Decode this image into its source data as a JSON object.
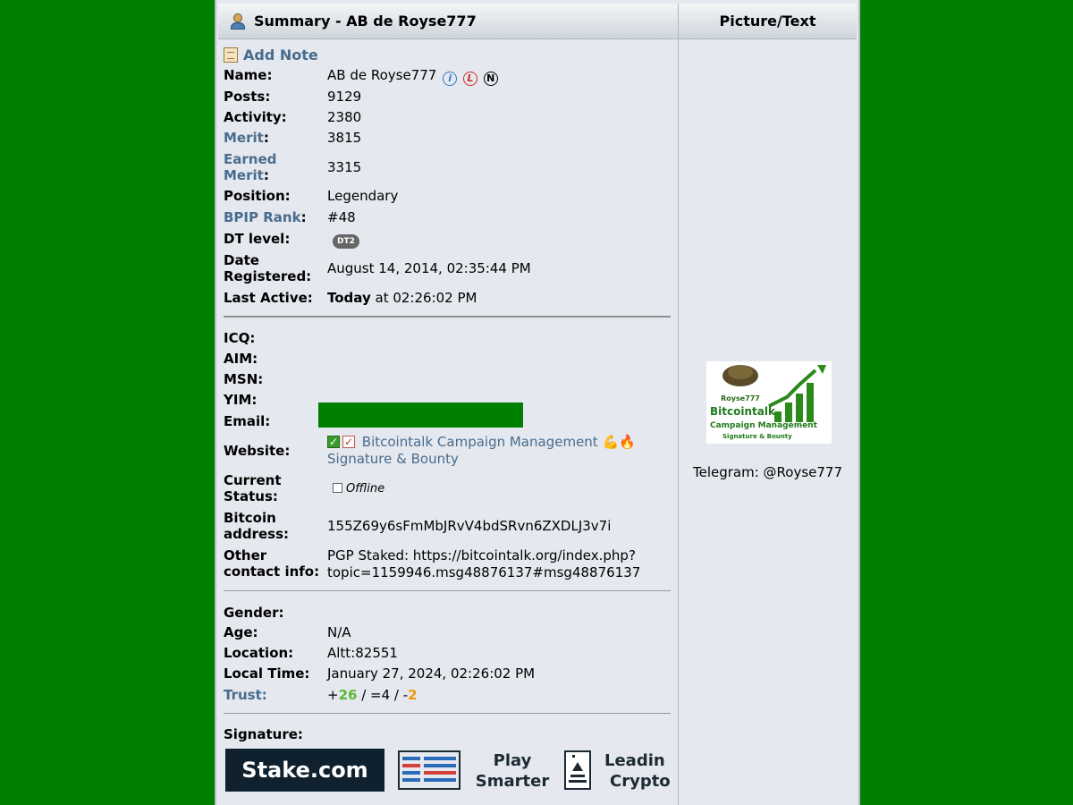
{
  "header": {
    "summary_title": "Summary - AB de Royse777",
    "picture_title": "Picture/Text"
  },
  "add_note": "Add Note",
  "profile": {
    "name_label": "Name:",
    "name": "AB de Royse777",
    "posts_label": "Posts:",
    "posts": "9129",
    "activity_label": "Activity:",
    "activity": "2380",
    "merit_label": "Merit",
    "merit": "3815",
    "earned_merit_label_1": "Earned",
    "earned_merit_label_2": "Merit",
    "earned_merit": "3315",
    "position_label": "Position:",
    "position": "Legendary",
    "bpip_label": "BPIP Rank",
    "bpip": "#48",
    "dt_label": "DT level:",
    "dt": "DT2",
    "registered_label_1": "Date",
    "registered_label_2": "Registered:",
    "registered": "August 14, 2014, 02:35:44 PM",
    "active_label": "Last Active:",
    "active_bold": "Today",
    "active_rest": " at 02:26:02 PM"
  },
  "contact": {
    "icq_label": "ICQ:",
    "aim_label": "AIM:",
    "msn_label": "MSN:",
    "yim_label": "YIM:",
    "email_label": "Email:",
    "website_label": "Website:",
    "website_line1": "Bitcointalk Campaign Management",
    "website_line2": "Signature & Bounty",
    "website_emoji": "💪🔥",
    "status_label_1": "Current",
    "status_label_2": "Status:",
    "status": "Offline",
    "btc_label_1": "Bitcoin",
    "btc_label_2": "address:",
    "btc": "155Z69y6sFmMbJRvV4bdSRvn6ZXDLJ3v7i",
    "other_label_1": "Other",
    "other_label_2": "contact info:",
    "other_line1": "PGP Staked: https://bitcointalk.org/index.php?",
    "other_line2": "topic=1159946.msg48876137#msg48876137"
  },
  "personal": {
    "gender_label": "Gender:",
    "age_label": "Age:",
    "age": "N/A",
    "location_label": "Location:",
    "location": "Altt:82551",
    "local_time_label": "Local Time:",
    "local_time": "January 27, 2024, 02:26:02 PM",
    "trust_label": "Trust:",
    "trust_plus": "+",
    "trust_pos": "26",
    "trust_mid": " / =4 / -",
    "trust_neg": "2"
  },
  "signature": {
    "label": "Signature:",
    "stake": "Stake.com",
    "play_1": "Play",
    "play_2": "Smarter",
    "lead_1": "Leadin",
    "lead_2": "Crypto"
  },
  "picture": {
    "logo_user": "Royse777",
    "logo_line1": "Bitcointalk",
    "logo_line2": "Campaign Management",
    "logo_line3": "Signature & Bounty",
    "telegram": "Telegram: @Royse777"
  },
  "colors": {
    "background": "#008000",
    "panel": "#e5e8ee",
    "link": "#476c8e",
    "trust_positive": "#5db838",
    "trust_negative": "#f09a00"
  }
}
